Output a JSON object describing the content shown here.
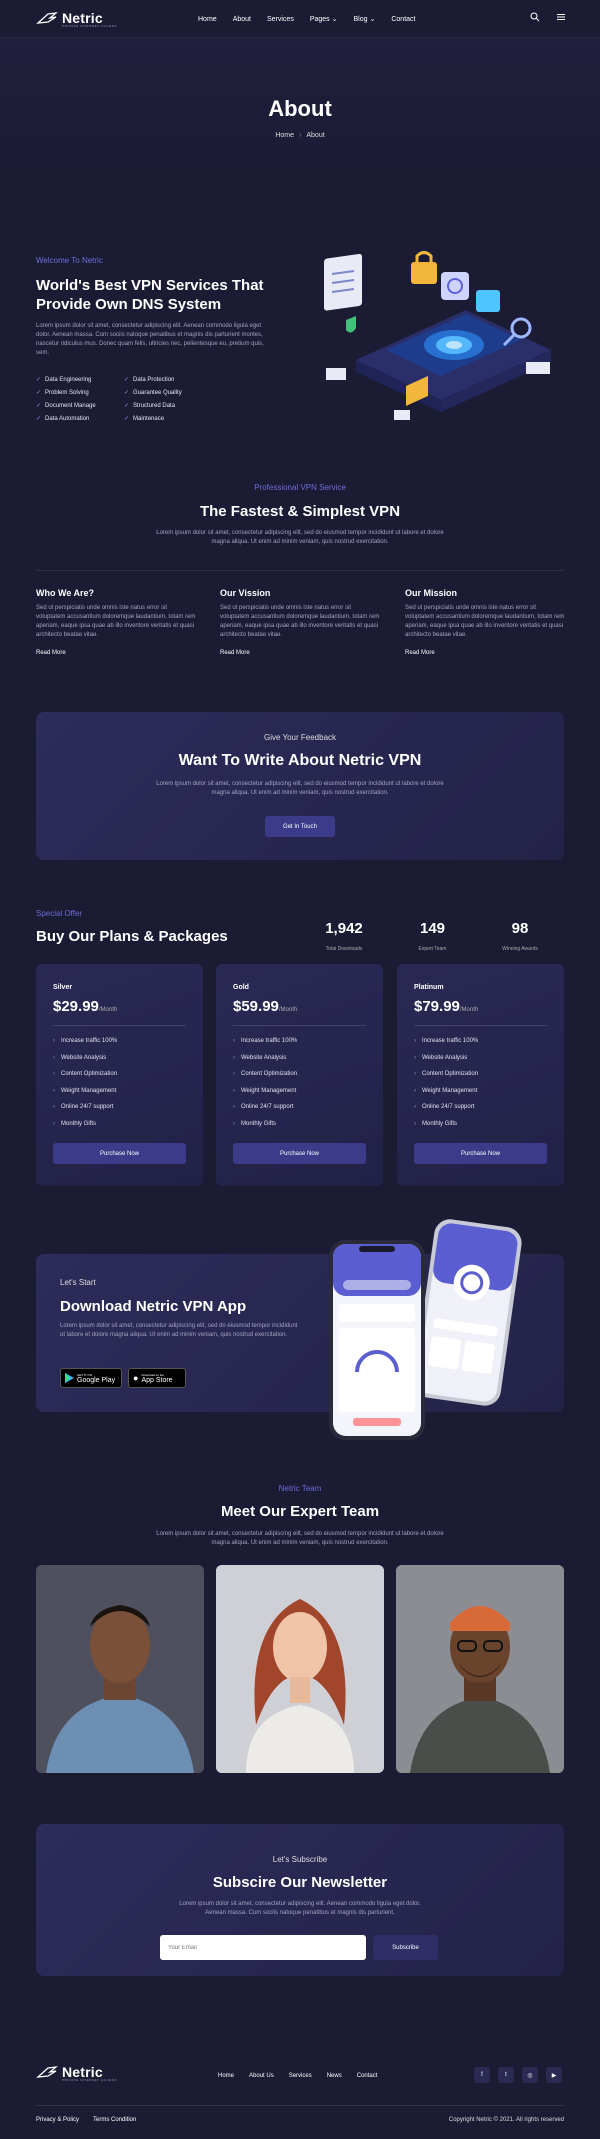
{
  "brand": {
    "name": "Netric",
    "tagline": "PRIVATE INTERNET ACCESS"
  },
  "nav": {
    "items": [
      "Home",
      "About",
      "Services",
      "Pages",
      "Blog",
      "Contact"
    ]
  },
  "hero": {
    "title": "About",
    "crumb_home": "Home",
    "crumb_current": "About"
  },
  "intro": {
    "eyebrow": "Welcome To Netric",
    "title_line1": "World's Best VPN Services That",
    "title_line2": "Provide Own DNS System",
    "body": "Lorem ipsum dolor sit amet, consectetur adipiscing elit. Aenean commodo ligula eget dolor. Aenean massa. Cum sociis natoque penatibus et magnis dis parturient montes, nascetur ridiculus mus. Donec quam felis, ultricies nec, pellentesque eu, pretium quis, sem.",
    "features": [
      "Data Engineering",
      "Data Protection",
      "Problem Solving",
      "Guarantee Quality",
      "Document Manage",
      "Structured Data",
      "Data Automation",
      "Maintenace"
    ]
  },
  "service": {
    "eyebrow": "Professional VPN Service",
    "title": "The Fastest & Simplest VPN",
    "body": "Lorem ipsum dolor sit amet, consectetur adipiscing elit, sed do eiusmod tempor incididunt ut labore et dolore magna aliqua. Ut enim ad minim veniam, quis nostrud exercitation.",
    "cards": [
      {
        "title": "Who We Are?",
        "body": "Sed ut perspiciatis unde omnis iste natus error sit voluptatem accusantium doloremque laudantium, totam rem aperiam, eaque ipsa quae ab illo inventore veritatis et quasi architecto beatae vitae.",
        "link": "Read More"
      },
      {
        "title": "Our Vission",
        "body": "Sed ut perspiciatis unde omnis iste natus error sit voluptatem accusantium doloremque laudantium, totam rem aperiam, eaque ipsa quae ab illo inventore veritatis et quasi architecto beatae vitae.",
        "link": "Read More"
      },
      {
        "title": "Our Mission",
        "body": "Sed ut perspiciatis unde omnis iste natus error sit voluptatem accusantium doloremque laudantium, totam rem aperiam, eaque ipsa quae ab illo inventore veritatis et quasi architecto beatae vitae.",
        "link": "Read More"
      }
    ]
  },
  "feedback": {
    "eyebrow": "Give Your Feedback",
    "title": "Want To Write About Netric VPN",
    "body": "Lorem ipsum dolor sit amet, consectetur adipiscing elit, sed do eiusmod tempor incididunt ut labore et dolore magna aliqua. Ut enim ad minim veniam, quis nostrud exercitation.",
    "button": "Get In Touch"
  },
  "plans": {
    "eyebrow": "Special Offer",
    "title": "Buy Our Plans & Packages",
    "stats": [
      {
        "value": "1,942",
        "label": "Total Downloads"
      },
      {
        "value": "149",
        "label": "Expert Team"
      },
      {
        "value": "98",
        "label": "Winning Awards"
      }
    ],
    "items": [
      {
        "name": "Silver",
        "price": "$29.99",
        "per": "/Month"
      },
      {
        "name": "Gold",
        "price": "$59.99",
        "per": "/Month"
      },
      {
        "name": "Platinum",
        "price": "$79.99",
        "per": "/Month"
      }
    ],
    "features": [
      "Increase traffic 100%",
      "Website Analysis",
      "Content Optimization",
      "Weight Management",
      "Online 24/7 support",
      "Monthly Gifts"
    ],
    "button": "Purchase Now"
  },
  "app": {
    "eyebrow": "Let's Start",
    "title": "Download Netric VPN App",
    "body": "Lorem ipsum dolor sit amet, consectetur adipiscing elit, sed do eiusmod tempor incididunt ut labore et dolore magna aliqua. Ut enim ad minim veniam, quis nostrud exercitation.",
    "google_small": "GET IT ON",
    "google": "Google Play",
    "apple_small": "Download on the",
    "apple": "App Store"
  },
  "team": {
    "eyebrow": "Netric Team",
    "title": "Meet Our Expert Team",
    "body": "Lorem ipsum dolor sit amet, consectetur adipiscing elit, sed do eiusmod tempor incididunt ut labore et dolore magna aliqua. Ut enim ad minim veniam, quis nostrud exercitation."
  },
  "newsletter": {
    "eyebrow": "Let's Subscribe",
    "title": "Subscire Our Newsletter",
    "body": "Lorem ipsum dolor sit amet, consectetur adipiscing elit. Aenean commodo ligula eget dolor. Aenean massa. Cum sociis natoque penatibus et magnis dis parturient.",
    "placeholder": "Your Email",
    "button": "Subscribe"
  },
  "footer": {
    "nav": [
      "Home",
      "About Us",
      "Services",
      "News",
      "Contact"
    ],
    "privacy": "Privacy & Policy",
    "terms": "Terms Condition",
    "copyright": "Copyright Netric © 2021. All rights reserved"
  },
  "colors": {
    "bg": "#1c1b34",
    "accent": "#6d6dd9",
    "button": "#3b3b8a"
  }
}
